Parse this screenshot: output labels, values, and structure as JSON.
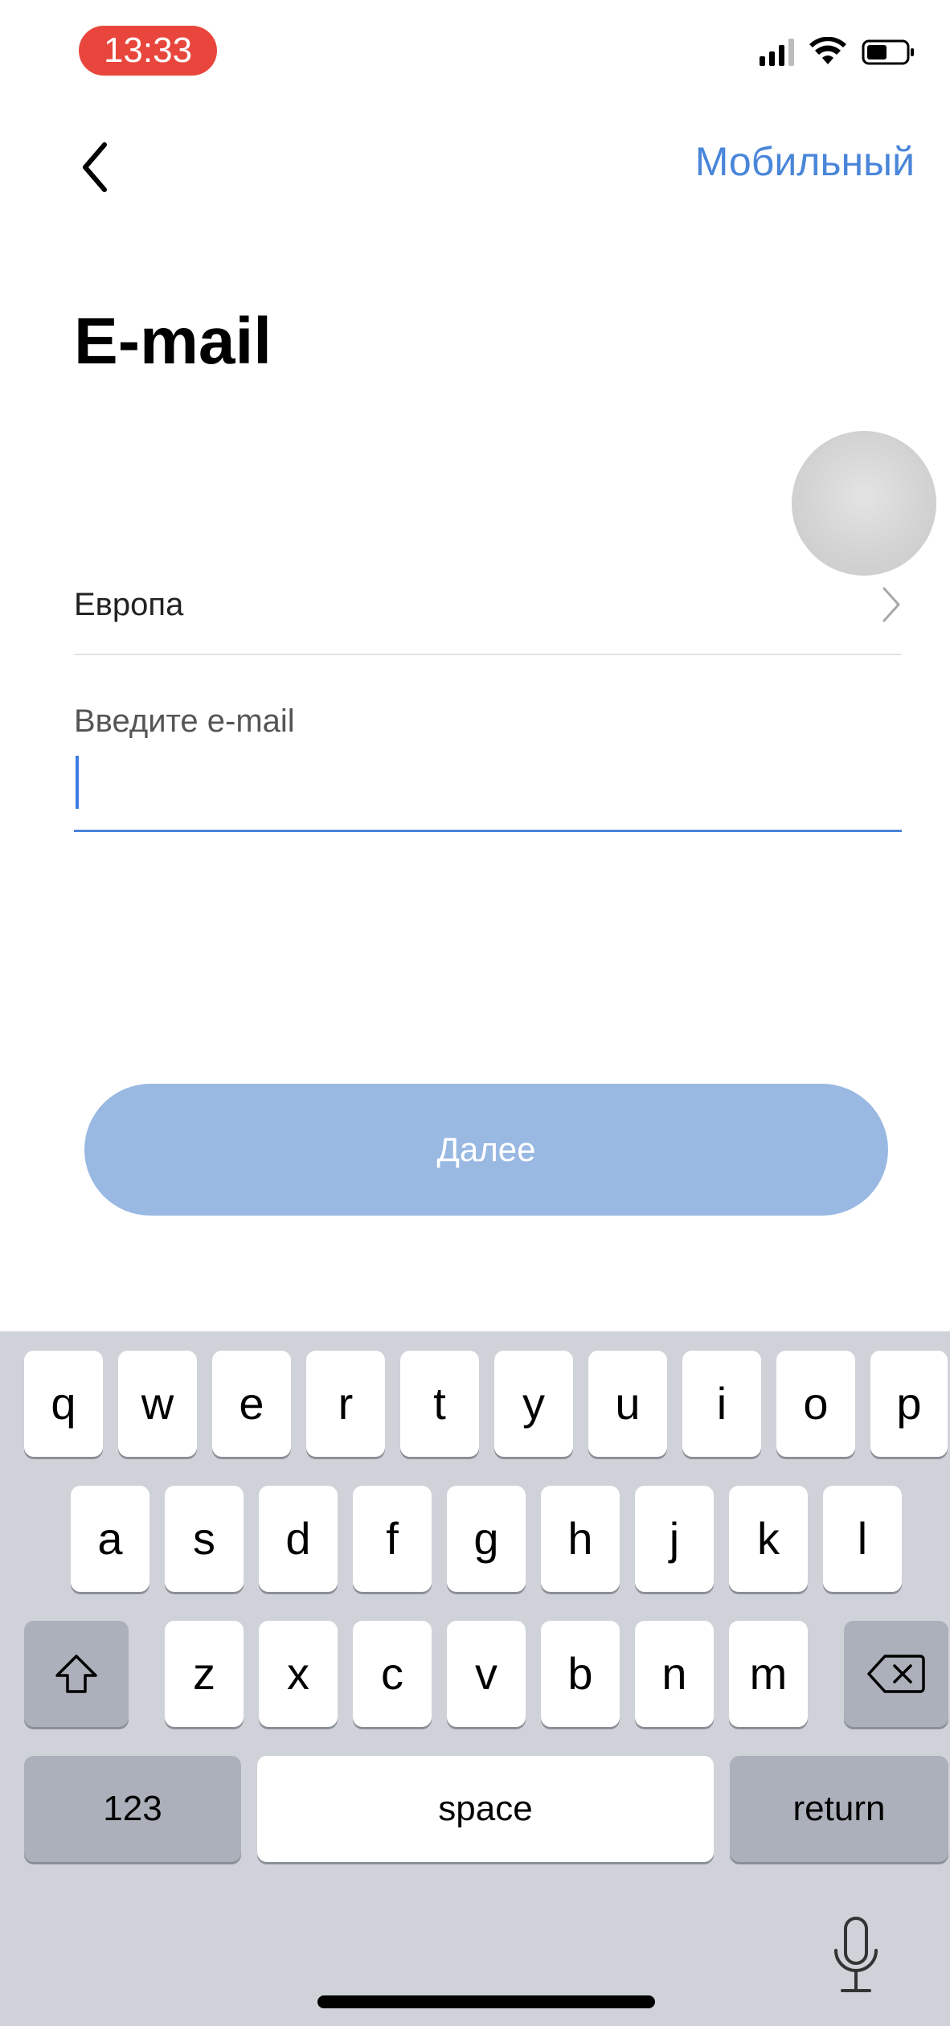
{
  "status_bar": {
    "time": "13:33"
  },
  "nav": {
    "right_link": "Мобильный"
  },
  "page": {
    "title": "E-mail"
  },
  "region": {
    "label": "Европа"
  },
  "email": {
    "placeholder": "Введите e-mail",
    "value": ""
  },
  "actions": {
    "next_label": "Далее"
  },
  "keyboard": {
    "row1": [
      "q",
      "w",
      "e",
      "r",
      "t",
      "y",
      "u",
      "i",
      "o",
      "p"
    ],
    "row2": [
      "a",
      "s",
      "d",
      "f",
      "g",
      "h",
      "j",
      "k",
      "l"
    ],
    "row3": [
      "z",
      "x",
      "c",
      "v",
      "b",
      "n",
      "m"
    ],
    "numbers_label": "123",
    "space_label": "space",
    "return_label": "return"
  },
  "icons": {
    "back": "chevron-left-icon",
    "region_arrow": "chevron-right-icon",
    "shift": "shift-icon",
    "backspace": "backspace-icon",
    "mic": "microphone-icon",
    "signal": "signal-icon",
    "wifi": "wifi-icon",
    "battery": "battery-icon"
  },
  "colors": {
    "accent": "#4a86d9",
    "button_disabled": "#99b9e3",
    "time_pill": "#e8463c",
    "keyboard_bg": "#cfd2d8"
  }
}
